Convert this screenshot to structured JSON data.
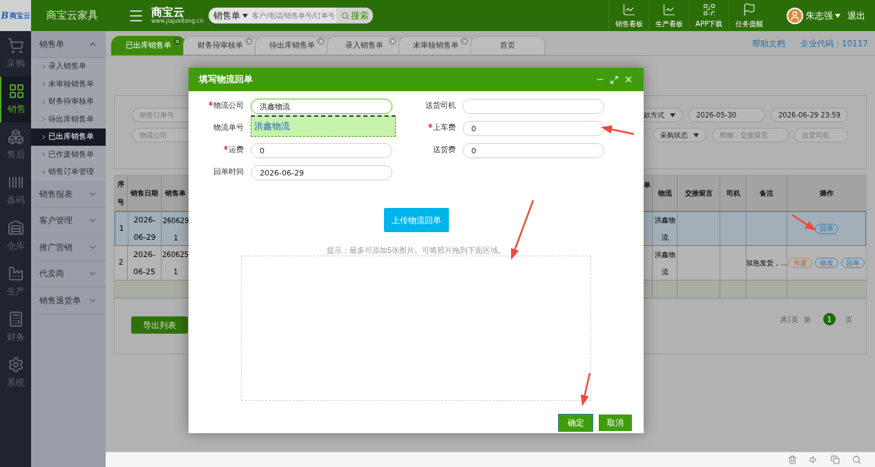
{
  "app": {
    "logo_mark": "B",
    "logo_name": "商宝云",
    "company": "商宝云家具",
    "brand": "商宝云",
    "brand_url": "www.jiajuxitong.cn"
  },
  "search": {
    "scope": "销售单",
    "placeholder": "客户/电话/销售单号/订单号",
    "button": "搜索"
  },
  "toolbar": [
    {
      "label": "销售看板",
      "kind": "chart"
    },
    {
      "label": "生产看板",
      "kind": "chart"
    },
    {
      "label": "APP下载",
      "kind": "qr"
    },
    {
      "label": "任务提醒",
      "kind": "flag"
    }
  ],
  "user": {
    "name": "朱志强",
    "logout": "退出"
  },
  "rail": [
    {
      "label": "采购",
      "kind": "cart",
      "selected": false
    },
    {
      "label": "销售",
      "kind": "sales",
      "selected": true
    },
    {
      "label": "售后",
      "kind": "boxes",
      "selected": false
    },
    {
      "label": "条码",
      "kind": "barcode",
      "selected": false
    },
    {
      "label": "仓库",
      "kind": "warehouse",
      "selected": false
    },
    {
      "label": "生产",
      "kind": "factory",
      "selected": false
    },
    {
      "label": "财务",
      "kind": "calculator",
      "selected": false
    },
    {
      "label": "系统",
      "kind": "settings",
      "selected": false
    }
  ],
  "sidebar": [
    {
      "label": "销售单",
      "expanded": true,
      "children": [
        {
          "label": "录入销售单",
          "selected": false
        },
        {
          "label": "未审核销售单",
          "selected": false
        },
        {
          "label": "财务待审核单",
          "selected": false
        },
        {
          "label": "待出库销售单",
          "selected": false
        },
        {
          "label": "已出库销售单",
          "selected": true
        },
        {
          "label": "已作废销售单",
          "selected": false
        },
        {
          "label": "销售订单管理",
          "selected": false
        }
      ]
    },
    {
      "label": "销售报表",
      "expanded": false
    },
    {
      "label": "客户管理",
      "expanded": false
    },
    {
      "label": "推广营销",
      "expanded": false
    },
    {
      "label": "代卖商",
      "expanded": false
    },
    {
      "label": "销售退货单",
      "expanded": false
    }
  ],
  "tabs": [
    {
      "label": "已出库销售单",
      "selected": true,
      "closable": true
    },
    {
      "label": "财务待审核单",
      "selected": false,
      "closable": true
    },
    {
      "label": "待出库销售单",
      "selected": false,
      "closable": true
    },
    {
      "label": "录入销售单",
      "selected": false,
      "closable": true
    },
    {
      "label": "未审核销售单",
      "selected": false,
      "closable": true
    },
    {
      "label": "首页",
      "selected": false,
      "closable": false
    }
  ],
  "header_links": {
    "help": "帮助文档",
    "company_code": "企业代码：10117"
  },
  "filters": {
    "left": [
      {
        "placeholder": "销售订单号"
      },
      {
        "placeholder": "物流公司"
      }
    ],
    "right": [
      [
        {
          "kind": "select",
          "value": "款方式"
        },
        {
          "kind": "date",
          "value": "2026-05-30"
        },
        {
          "kind": "date",
          "value": "2026-06-29 23:59"
        }
      ],
      [
        {
          "kind": "select",
          "value": "采购状态"
        },
        {
          "kind": "input",
          "placeholder": "模糊：交接留言"
        },
        {
          "kind": "input",
          "placeholder": "送货司机"
        }
      ]
    ]
  },
  "table": {
    "columns_left": [
      "序号",
      "销售日期",
      "销售单"
    ],
    "columns_right": [
      "单",
      "物流",
      "交接留言",
      "司机",
      "备注",
      "操作"
    ],
    "rows": [
      {
        "selected": true,
        "index": "1",
        "date": "2026-06-29",
        "number": [
          "260629",
          "1"
        ],
        "logistics": "洪鑫物流",
        "note": "",
        "actions": [
          {
            "label": "回单",
            "kind": "receipt"
          }
        ]
      },
      {
        "selected": false,
        "index": "2",
        "date": "2026-06-25",
        "number": [
          "260625",
          "1"
        ],
        "logistics": "洪鑫物流",
        "note": "加急发货，...",
        "actions": [
          {
            "label": "作废",
            "kind": "void"
          },
          {
            "label": "修改",
            "kind": "edit"
          },
          {
            "label": "回单",
            "kind": "receipt"
          }
        ]
      }
    ]
  },
  "export_button": "导出列表",
  "pager": {
    "total_prefix": "共",
    "total": "1",
    "total_suffix": "页",
    "page_prefix": "第",
    "page": "1",
    "page_suffix": "页"
  },
  "modal": {
    "title": "填写物流回单",
    "fields": [
      {
        "label": "物流公司",
        "required": true,
        "value": "洪鑫物流",
        "focused": true
      },
      {
        "label": "送货司机",
        "required": false,
        "focused": false
      },
      {
        "label": "物流单号",
        "required": false,
        "focused": false,
        "suggestion": "洪鑫物流"
      },
      {
        "label": "上车费",
        "required": true,
        "value": "0",
        "focused": false
      },
      {
        "label": "运费",
        "required": true,
        "value": "0",
        "focused": false
      },
      {
        "label": "送货费",
        "required": false,
        "value": "0",
        "focused": false
      },
      {
        "label": "回单时间",
        "required": false,
        "value": "2026-06-29",
        "focused": false
      }
    ],
    "upload_button": "上传物流回单",
    "hint": "提示：最多可添加5张图片。可将照片拖到下面区域。",
    "confirm": "确定",
    "cancel": "取消"
  }
}
